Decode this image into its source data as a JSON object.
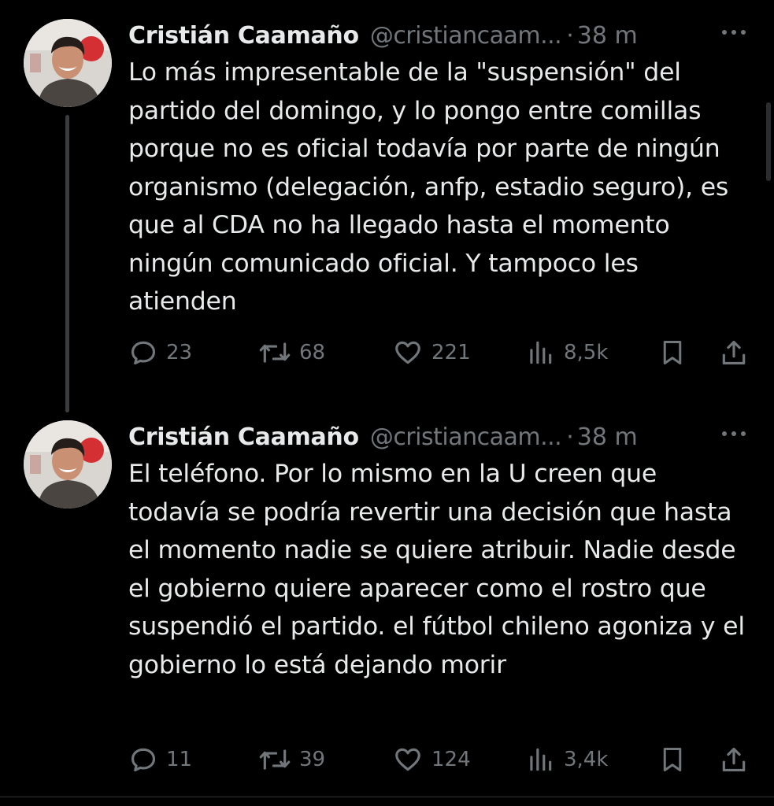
{
  "colors": {
    "background": "#000000",
    "primary_text": "#e7e9ea",
    "secondary_text": "#71767b",
    "thread_line": "#3a3d40"
  },
  "icons": {
    "reply": "speech-bubble",
    "retweet": "repost-arrows",
    "like": "heart",
    "views": "bar-chart",
    "bookmark": "bookmark",
    "share": "upload-arrow",
    "more": "horizontal-ellipsis"
  },
  "tweets": [
    {
      "display_name": "Cristián Caamaño",
      "handle": "@cristiancaam...",
      "separator": "·",
      "time": "38 m",
      "text": "Lo más impresentable de la \"suspensión\" del partido del domingo, y lo pongo entre comillas porque no es oficial todavía por parte de ningún organismo (delegación, anfp, estadio seguro), es que al CDA no ha llegado hasta el momento ningún comunicado oficial. Y tampoco les atienden",
      "replies": "23",
      "reposts": "68",
      "likes": "221",
      "views": "8,5k"
    },
    {
      "display_name": "Cristián Caamaño",
      "handle": "@cristiancaam...",
      "separator": "·",
      "time": "38 m",
      "text": "El teléfono. Por lo mismo en la U creen que todavía se podría revertir una decisión que hasta el momento nadie se quiere atribuir. Nadie desde el gobierno quiere aparecer como el rostro que suspendió el partido. el fútbol chileno agoniza y el gobierno lo está dejando morir",
      "replies": "11",
      "reposts": "39",
      "likes": "124",
      "views": "3,4k"
    }
  ]
}
